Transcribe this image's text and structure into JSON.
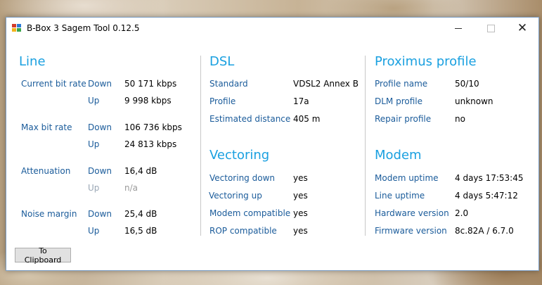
{
  "window": {
    "title": "B-Box 3 Sagem Tool 0.12.5",
    "accent_color": "#1aa0e0",
    "label_color": "#1a5b9a"
  },
  "line": {
    "title": "Line",
    "current_bit_rate": {
      "label": "Current bit rate",
      "down_label": "Down",
      "down": "50 171 kbps",
      "up_label": "Up",
      "up": "9 998 kbps"
    },
    "max_bit_rate": {
      "label": "Max bit rate",
      "down_label": "Down",
      "down": "106 736 kbps",
      "up_label": "Up",
      "up": "24 813 kbps"
    },
    "attenuation": {
      "label": "Attenuation",
      "down_label": "Down",
      "down": "16,4 dB",
      "up_label": "Up",
      "up": "n/a"
    },
    "noise_margin": {
      "label": "Noise margin",
      "down_label": "Down",
      "down": "25,4 dB",
      "up_label": "Up",
      "up": "16,5 dB"
    }
  },
  "dsl": {
    "title": "DSL",
    "standard": {
      "label": "Standard",
      "value": "VDSL2 Annex B"
    },
    "profile": {
      "label": "Profile",
      "value": "17a"
    },
    "estimated_distance": {
      "label": "Estimated distance",
      "value": "405 m"
    }
  },
  "vectoring": {
    "title": "Vectoring",
    "vectoring_down": {
      "label": "Vectoring down",
      "value": "yes"
    },
    "vectoring_up": {
      "label": "Vectoring up",
      "value": "yes"
    },
    "modem_compatible": {
      "label": "Modem compatible",
      "value": "yes"
    },
    "rop_compatible": {
      "label": "ROP compatible",
      "value": "yes"
    }
  },
  "proximus_profile": {
    "title": "Proximus profile",
    "profile_name": {
      "label": "Profile name",
      "value": "50/10"
    },
    "dlm_profile": {
      "label": "DLM profile",
      "value": "unknown"
    },
    "repair_profile": {
      "label": "Repair profile",
      "value": "no"
    }
  },
  "modem": {
    "title": "Modem",
    "modem_uptime": {
      "label": "Modem uptime",
      "value": "4 days 17:53:45"
    },
    "line_uptime": {
      "label": "Line uptime",
      "value": "4 days 5:47:12"
    },
    "hardware_version": {
      "label": "Hardware version",
      "value": "2.0"
    },
    "firmware_version": {
      "label": "Firmware version",
      "value": "8c.82A / 6.7.0"
    }
  },
  "actions": {
    "clipboard_label": "To Clipboard"
  },
  "icons": [
    "app-icon",
    "minimize-icon",
    "maximize-icon",
    "close-icon"
  ]
}
